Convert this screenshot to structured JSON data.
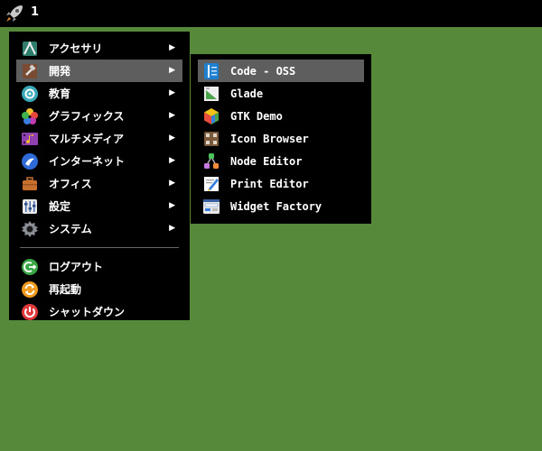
{
  "taskbar": {
    "workspace_number": "1"
  },
  "main_menu": {
    "categories": [
      {
        "label": "アクセサリ",
        "icon": "accessories-icon"
      },
      {
        "label": "開発",
        "icon": "development-icon"
      },
      {
        "label": "教育",
        "icon": "education-icon"
      },
      {
        "label": "グラフィックス",
        "icon": "graphics-icon"
      },
      {
        "label": "マルチメディア",
        "icon": "multimedia-icon"
      },
      {
        "label": "インターネット",
        "icon": "internet-icon"
      },
      {
        "label": "オフィス",
        "icon": "office-icon"
      },
      {
        "label": "設定",
        "icon": "settings-icon"
      },
      {
        "label": "システム",
        "icon": "system-icon"
      }
    ],
    "actions": [
      {
        "label": "ログアウト",
        "icon": "logout-icon"
      },
      {
        "label": "再起動",
        "icon": "reboot-icon"
      },
      {
        "label": "シャットダウン",
        "icon": "shutdown-icon"
      }
    ],
    "active_category": "開発",
    "submenu_arrow": "▶"
  },
  "sub_menu": {
    "items": [
      {
        "label": "Code - OSS",
        "icon": "code-oss-icon"
      },
      {
        "label": "Glade",
        "icon": "glade-icon"
      },
      {
        "label": "GTK Demo",
        "icon": "gtk-demo-icon"
      },
      {
        "label": "Icon Browser",
        "icon": "icon-browser-icon"
      },
      {
        "label": "Node Editor",
        "icon": "node-editor-icon"
      },
      {
        "label": "Print Editor",
        "icon": "print-editor-icon"
      },
      {
        "label": "Widget Factory",
        "icon": "widget-factory-icon"
      }
    ],
    "active_item": "Code - OSS"
  },
  "colors": {
    "desktop": "#568a3a",
    "panel": "#000000",
    "highlight": "#5e5e5e",
    "text": "#ffffff"
  }
}
